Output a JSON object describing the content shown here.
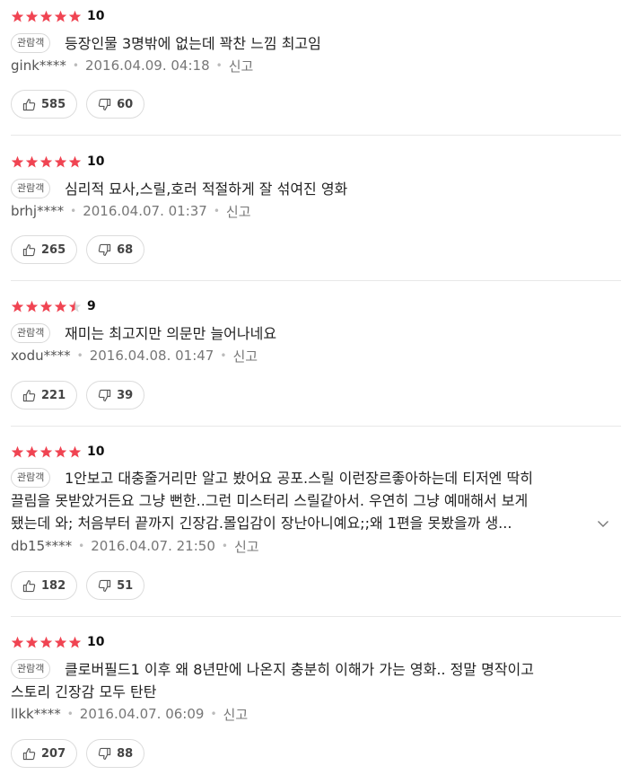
{
  "badge_label": "관람객",
  "report_label": "신고",
  "colors": {
    "star": "#f04452",
    "star_empty": "#d8d8d8"
  },
  "reviews": [
    {
      "rating": 10,
      "stars": 5,
      "text_lines": [
        "등장인물 3명밖에 없는데 꽉찬 느낌 최고임"
      ],
      "user": "gink****",
      "date": "2016.04.09. 04:18",
      "likes": "585",
      "dislikes": "60"
    },
    {
      "rating": 10,
      "stars": 5,
      "text_lines": [
        "심리적 묘사,스릴,호러 적절하게 잘 섞여진 영화"
      ],
      "user": "brhj****",
      "date": "2016.04.07. 01:37",
      "likes": "265",
      "dislikes": "68"
    },
    {
      "rating": 9,
      "stars": 4.5,
      "text_lines": [
        "재미는 최고지만 의문만 늘어나네요"
      ],
      "user": "xodu****",
      "date": "2016.04.08. 01:47",
      "likes": "221",
      "dislikes": "39"
    },
    {
      "rating": 10,
      "stars": 5,
      "text_lines": [
        "1안보고 대충줄거리만 알고 봤어요 공포.스릴 이런장르좋아하는데 티저엔 딱히",
        "끌림을 못받았거든요 그냥 뻔한..그런 미스터리 스릴같아서. 우연히 그냥 예매해서 보게",
        "됐는데 와; 처음부터 끝까지 긴장감.몰입감이 장난아니예요;;왜 1편을 못봤을까 생..."
      ],
      "expandable": true,
      "user": "db15****",
      "date": "2016.04.07. 21:50",
      "likes": "182",
      "dislikes": "51"
    },
    {
      "rating": 10,
      "stars": 5,
      "text_lines": [
        "클로버필드1 이후 왜 8년만에 나온지 충분히 이해가 가는 영화.. 정말 명작이고",
        "스토리 긴장감 모두 탄탄"
      ],
      "user": "llkk****",
      "date": "2016.04.07. 06:09",
      "likes": "207",
      "dislikes": "88"
    }
  ]
}
